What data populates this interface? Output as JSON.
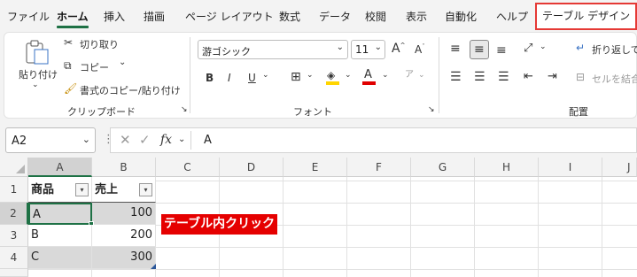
{
  "tabs": [
    {
      "label": "ファイル"
    },
    {
      "label": "ホーム"
    },
    {
      "label": "挿入"
    },
    {
      "label": "描画"
    },
    {
      "label": "ページ レイアウト"
    },
    {
      "label": "数式"
    },
    {
      "label": "データ"
    },
    {
      "label": "校閲"
    },
    {
      "label": "表示"
    },
    {
      "label": "自動化"
    },
    {
      "label": "ヘルプ"
    },
    {
      "label": "テーブル デザイン"
    }
  ],
  "clipboard": {
    "paste": "貼り付け",
    "cut": "切り取り",
    "copy": "コピー",
    "format_painter": "書式のコピー/貼り付け",
    "group": "クリップボード"
  },
  "font": {
    "name": "游ゴシック",
    "size": "11",
    "group": "フォント"
  },
  "alignment": {
    "wrap": "折り返して",
    "merge": "セルを結合",
    "group": "配置"
  },
  "formula_bar": {
    "name_box": "A2",
    "value": "A",
    "fx": "fx"
  },
  "columns": [
    "A",
    "B",
    "C",
    "D",
    "E",
    "F",
    "G",
    "H",
    "I",
    "J"
  ],
  "rows": [
    "1",
    "2",
    "3",
    "4"
  ],
  "table": {
    "headers": [
      "商品",
      "売上"
    ],
    "data": [
      [
        "A",
        "100"
      ],
      [
        "B",
        "200"
      ],
      [
        "C",
        "300"
      ]
    ]
  },
  "annotation": "テーブル内クリック",
  "colors": {
    "accent": "#1e7145",
    "highlight_border": "#e53935",
    "annotation_bg": "#e50000",
    "band": "#d9d9d9"
  }
}
